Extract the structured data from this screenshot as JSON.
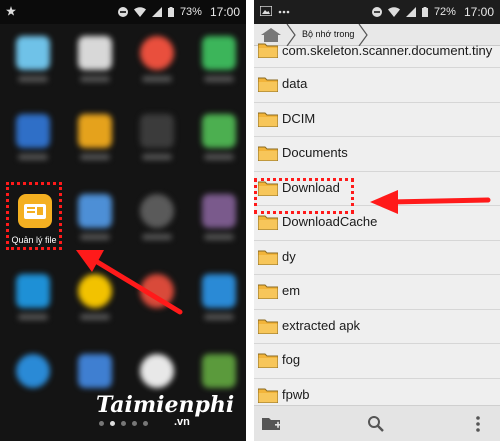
{
  "left_phone": {
    "status": {
      "battery": "73%",
      "time": "17:00"
    },
    "file_manager_app": {
      "label": "Quản lý file"
    }
  },
  "right_phone": {
    "status": {
      "battery": "72%",
      "time": "17:00"
    },
    "breadcrumb": {
      "current": "Bộ nhớ trong"
    },
    "folders": [
      "com.skeleton.scanner.document.tiny",
      "data",
      "DCIM",
      "Documents",
      "Download",
      "DownloadCache",
      "dy",
      "em",
      "extracted apk",
      "fog",
      "fpwb"
    ],
    "highlighted_folder": "Download"
  },
  "watermark": {
    "brand": "Taimienphi",
    "suffix": ".vn"
  },
  "colors": {
    "highlight": "#ff1a1a",
    "folder": "#f2b43a",
    "app_icon": "#f4b021"
  }
}
